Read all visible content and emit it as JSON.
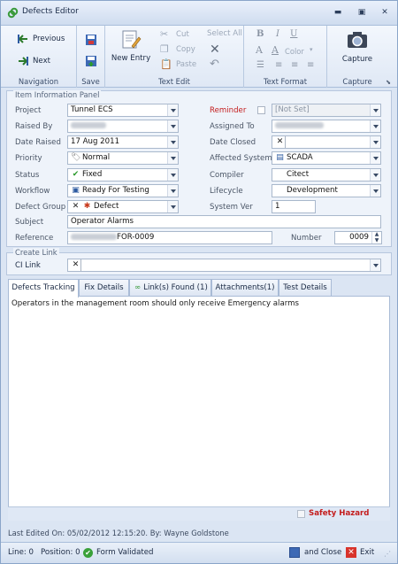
{
  "window": {
    "title": "Defects Editor"
  },
  "ribbon": {
    "navigation": {
      "label": "Navigation",
      "previous": "Previous",
      "next": "Next"
    },
    "save": {
      "label": "Save"
    },
    "text_edit": {
      "label": "Text Edit",
      "new_entry": "New Entry",
      "cut": "Cut",
      "copy": "Copy",
      "paste": "Paste",
      "select_all": "Select All"
    },
    "text_format": {
      "label": "Text Format",
      "bold": "B",
      "italic": "I",
      "underline": "U",
      "font_a1": "A",
      "font_a2": "A",
      "color": "Color"
    },
    "capture": {
      "label": "Capture",
      "button": "Capture"
    }
  },
  "item_panel": {
    "title": "Item Information Panel",
    "project": {
      "label": "Project",
      "value": "Tunnel ECS"
    },
    "raised_by": {
      "label": "Raised By"
    },
    "date_raised": {
      "label": "Date Raised",
      "value": "17 Aug 2011"
    },
    "priority": {
      "label": "Priority",
      "value": "Normal"
    },
    "status": {
      "label": "Status",
      "value": "Fixed"
    },
    "workflow": {
      "label": "Workflow",
      "value": "Ready For Testing"
    },
    "defect_group": {
      "label": "Defect Group",
      "value": "Defect"
    },
    "subject": {
      "label": "Subject",
      "value": "Operator Alarms"
    },
    "reference": {
      "label": "Reference",
      "value": "FOR-0009"
    },
    "reminder": {
      "label": "Reminder",
      "value": "[Not Set]"
    },
    "assigned_to": {
      "label": "Assigned To"
    },
    "date_closed": {
      "label": "Date Closed"
    },
    "affected_system": {
      "label": "Affected System",
      "value": "SCADA"
    },
    "compiler": {
      "label": "Compiler",
      "value": "Citect"
    },
    "lifecycle": {
      "label": "Lifecycle",
      "value": "Development"
    },
    "system_ver": {
      "label": "System Ver",
      "value": "1"
    },
    "number": {
      "label": "Number",
      "value": "0009"
    }
  },
  "create_link": {
    "title": "Create Link",
    "ci_link_label": "CI Link"
  },
  "tabs": [
    {
      "label": "Defects Tracking"
    },
    {
      "label": "Fix Details"
    },
    {
      "label": "Link(s) Found (1)"
    },
    {
      "label": "Attachments(1)"
    },
    {
      "label": "Test Details"
    }
  ],
  "editor": {
    "text": "Operators in the management room should only receive Emergency alarms"
  },
  "safety_hazard": {
    "label": "Safety Hazard"
  },
  "footer": {
    "last_edited": "Last Edited On: 05/02/2012 12:15:20. By: Wayne Goldstone"
  },
  "statusbar": {
    "line": "Line: 0",
    "position": "Position: 0",
    "form_validated": "Form Validated",
    "save_close": "and Close",
    "exit": "Exit"
  },
  "colors": {
    "accent": "#c41d1d",
    "ok": "#3aa13a"
  }
}
